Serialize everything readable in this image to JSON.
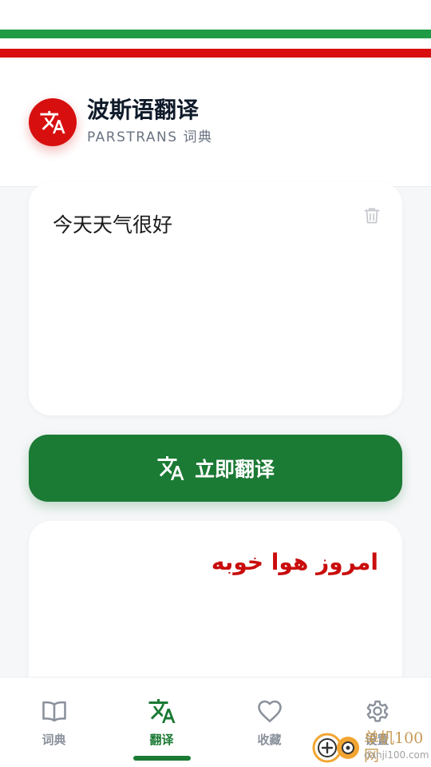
{
  "colors": {
    "primary_green": "#1b7a34",
    "flag_green": "#1f9a45",
    "flag_red": "#d90f0f",
    "output_red": "#c90c0c"
  },
  "header": {
    "title": "波斯语翻译",
    "subtitle": "PARSTRANS 词典",
    "logo_icon": "translate-icon"
  },
  "input": {
    "text": "今天天气很好",
    "clear_icon": "trash-icon"
  },
  "translate_button": {
    "label": "立即翻译",
    "icon": "translate-icon"
  },
  "output": {
    "text": "امروز هوا خوبه"
  },
  "nav": {
    "items": [
      {
        "label": "词典",
        "icon": "book-icon",
        "active": false
      },
      {
        "label": "翻译",
        "icon": "translate-icon",
        "active": true
      },
      {
        "label": "收藏",
        "icon": "heart-icon",
        "active": false
      },
      {
        "label": "设置",
        "icon": "gear-icon",
        "active": false
      }
    ]
  },
  "watermark": {
    "line1": "单机100网",
    "line2": "danji100.com"
  }
}
